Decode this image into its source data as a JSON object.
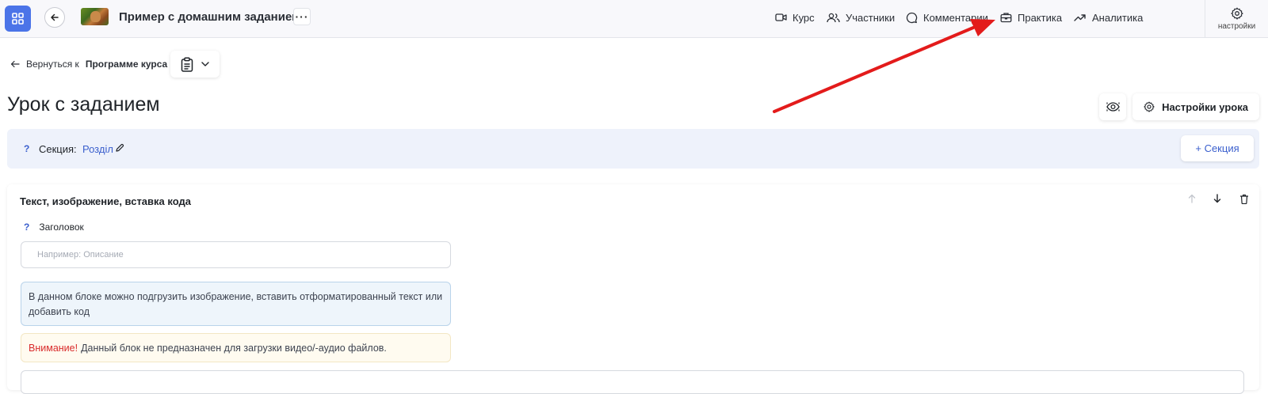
{
  "header": {
    "course_title": "Пример с домашним заданием",
    "more_label": "···",
    "nav": [
      {
        "label": "Курс",
        "icon": "video-icon"
      },
      {
        "label": "Участники",
        "icon": "users-icon"
      },
      {
        "label": "Комментарии",
        "icon": "comment-icon"
      },
      {
        "label": "Практика",
        "icon": "briefcase-icon"
      },
      {
        "label": "Аналитика",
        "icon": "trend-icon"
      }
    ],
    "settings_label": "настройки"
  },
  "breadcrumb": {
    "prefix": "Вернуться к",
    "target": "Программе курса"
  },
  "page": {
    "title": "Урок с заданием",
    "lesson_settings_label": "Настройки урока"
  },
  "section": {
    "help": "?",
    "label": "Секция:",
    "name": "Розділ",
    "add_label": "+ Секция"
  },
  "block": {
    "title": "Текст, изображение, вставка кода",
    "help": "?",
    "field_label": "Заголовок",
    "field_placeholder": "Например: Описание",
    "field_value": "",
    "info_text": "В данном блоке можно подгрузить изображение, вставить отформатированный текст или добавить код",
    "warning_label": "Внимание!",
    "warning_text": "Данный блок не предназначен для загрузки видео/-аудио файлов."
  },
  "colors": {
    "accent": "#4b74e8",
    "link": "#3a5fcd",
    "annotation_arrow": "#e31b1b",
    "warning": "#d92b2b"
  }
}
